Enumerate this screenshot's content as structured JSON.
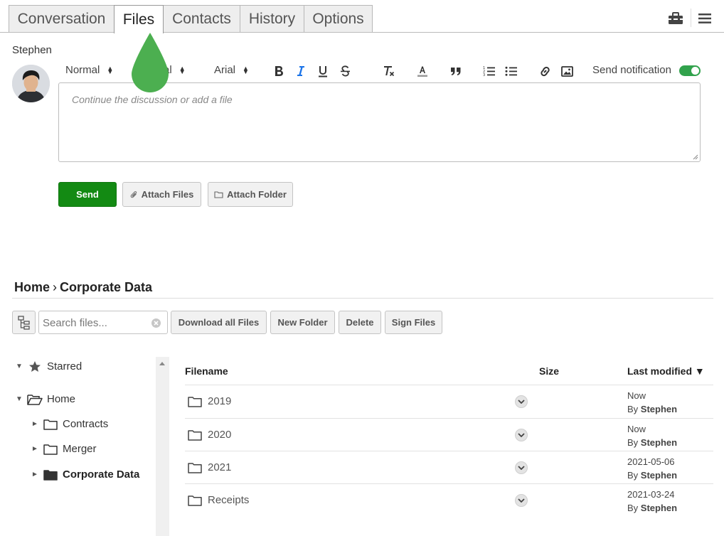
{
  "tabs": [
    {
      "label": "Conversation",
      "active": false
    },
    {
      "label": "Files",
      "active": true
    },
    {
      "label": "Contacts",
      "active": false
    },
    {
      "label": "History",
      "active": false
    },
    {
      "label": "Options",
      "active": false
    }
  ],
  "toolbar_icons": [
    "toolbox-icon",
    "hamburger-menu-icon"
  ],
  "composer": {
    "author": "Stephen",
    "format_select": "Normal",
    "size_select": "al",
    "font_select": "Arial",
    "notification_label": "Send notification",
    "notification_on": true,
    "placeholder": "Continue the discussion or add a file",
    "send_label": "Send",
    "attach_files_label": "Attach Files",
    "attach_folder_label": "Attach Folder"
  },
  "breadcrumb": {
    "home": "Home",
    "separator": "›",
    "current": "Corporate Data"
  },
  "file_toolbar": {
    "search_placeholder": "Search files...",
    "download_all": "Download all Files",
    "new_folder": "New Folder",
    "delete": "Delete",
    "sign_files": "Sign Files"
  },
  "tree": {
    "starred": "Starred",
    "home": "Home",
    "children": [
      "Contracts",
      "Merger",
      "Corporate Data"
    ],
    "selected": "Corporate Data"
  },
  "table": {
    "col_filename": "Filename",
    "col_size": "Size",
    "col_modified": "Last modified",
    "sort_indicator": "▼",
    "by_prefix": "By",
    "rows": [
      {
        "name": "2019",
        "size": "",
        "modified": "Now",
        "by": "Stephen"
      },
      {
        "name": "2020",
        "size": "",
        "modified": "Now",
        "by": "Stephen"
      },
      {
        "name": "2021",
        "size": "",
        "modified": "2021-05-06",
        "by": "Stephen"
      },
      {
        "name": "Receipts",
        "size": "",
        "modified": "2021-03-24",
        "by": "Stephen"
      }
    ]
  },
  "colors": {
    "accent_green": "#138a13",
    "toggle_green": "#31a24c",
    "marker_green": "#4caf50",
    "italic_blue": "#1a73e8"
  }
}
